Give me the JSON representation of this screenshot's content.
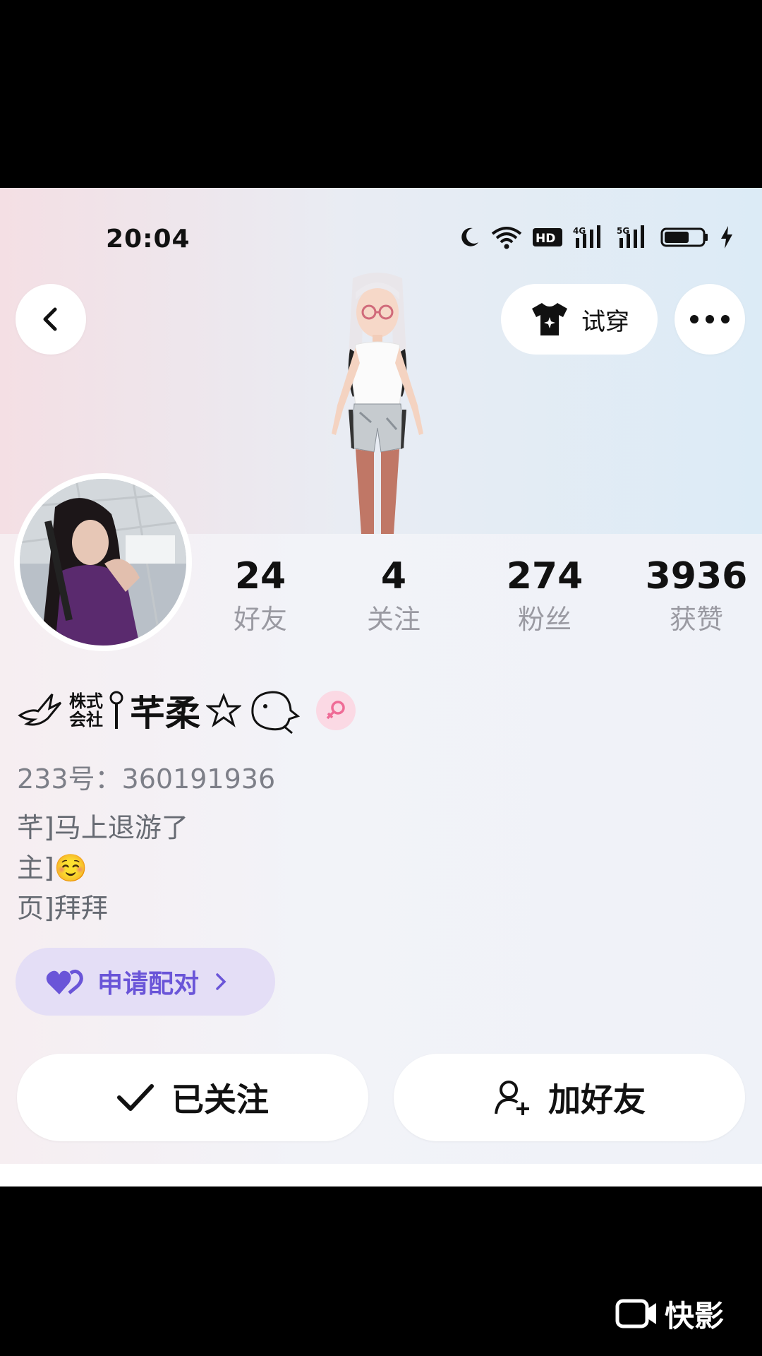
{
  "status_bar": {
    "time": "20:04",
    "net_4g": "4G",
    "net_5g": "5G",
    "hd": "HD"
  },
  "header": {
    "tryon_label": "试穿"
  },
  "stats": [
    {
      "value": "24",
      "label": "好友"
    },
    {
      "value": "4",
      "label": "关注"
    },
    {
      "value": "274",
      "label": "粉丝"
    },
    {
      "value": "3936",
      "label": "获赞"
    }
  ],
  "profile": {
    "name_prefix_a": "株式",
    "name_prefix_b": "会社",
    "name": "芊柔",
    "uid": "233号：360191936",
    "bio": [
      "芊]马上退游了",
      "主]",
      "页]拜拜"
    ],
    "bio_emoji": "☺️"
  },
  "pair_button": {
    "label": "申请配对"
  },
  "actions": {
    "following_label": "已关注",
    "add_friend_label": "加好友"
  },
  "watermark": {
    "label": "快影"
  },
  "colors": {
    "accent_purple": "#6a55d8",
    "gender_pink": "#ef6b96"
  }
}
